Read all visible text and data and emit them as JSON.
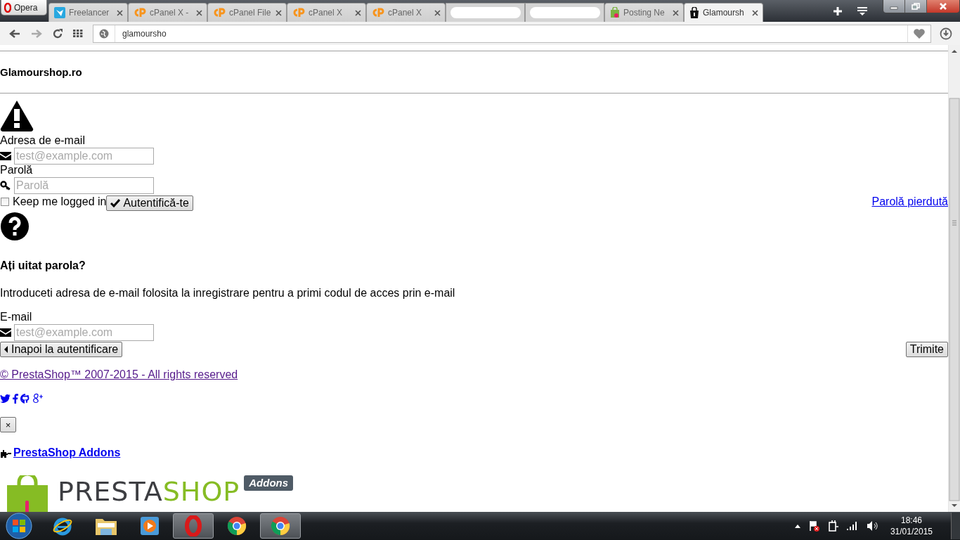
{
  "browser": {
    "opera_button": "Opera",
    "tabs": [
      {
        "kind": "freelancer",
        "label": "Freelancer",
        "selected": false
      },
      {
        "kind": "cpanel",
        "label": "cPanel X -",
        "selected": false
      },
      {
        "kind": "cpanel",
        "label": "cPanel File",
        "selected": false
      },
      {
        "kind": "cpanel",
        "label": "cPanel X",
        "selected": false
      },
      {
        "kind": "cpanel",
        "label": "cPanel X",
        "selected": false
      },
      {
        "kind": "redacted",
        "selected": false
      },
      {
        "kind": "redacted",
        "selected": false
      },
      {
        "kind": "cart",
        "label": "Posting Ne",
        "selected": false
      },
      {
        "kind": "bag",
        "label": "Glamoursh",
        "selected": true
      }
    ],
    "address": "glamoursho"
  },
  "page": {
    "shop_name": "Glamourshop.ro",
    "login": {
      "email_label": "Adresa de e-mail",
      "email_placeholder": "test@example.com",
      "password_label": "Parolă",
      "password_placeholder": "Parolă",
      "remember": {
        "label": "Keep me logged in",
        "checked": false
      },
      "submit": "Autentifică-te",
      "lost_password_link": "Parolă pierdută"
    },
    "forgot": {
      "title": "Ați uitat parola?",
      "text": "Introduceti adresa de e-mail folosita la inregistrare pentru a primi codul de acces prin e-mail",
      "email_label": "E-mail",
      "email_placeholder": "test@example.com",
      "back_button": "Inapoi la autentificare",
      "send_button": "Trimite"
    },
    "footer": {
      "copyright": "© PrestaShop™ 2007-2015 - All rights reserved",
      "social": [
        {
          "kind": "twitter"
        },
        {
          "kind": "facebook"
        },
        {
          "kind": "github"
        },
        {
          "kind": "googleplus"
        }
      ],
      "close_button": "×",
      "addons_link": "PrestaShop Addons",
      "logo": {
        "word_1": "PRESTA",
        "word_2": "SHOP",
        "badge": "Addons"
      }
    }
  },
  "taskbar": {
    "apps": [
      {
        "kind": "ie",
        "active": false
      },
      {
        "kind": "explorer",
        "active": false
      },
      {
        "kind": "media",
        "active": false
      },
      {
        "kind": "opera",
        "active": true
      },
      {
        "kind": "chrome",
        "active": false
      },
      {
        "kind": "chrome",
        "active": true
      }
    ],
    "time": "18:46",
    "date": "31/01/2015"
  }
}
